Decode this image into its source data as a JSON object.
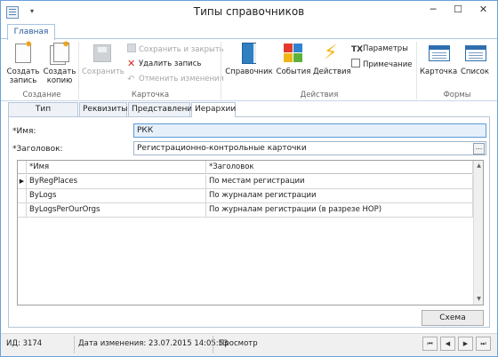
{
  "window": {
    "title": "Типы справочников",
    "quick_access": "▾",
    "minimize": "─",
    "maximize": "☐",
    "close": "✕"
  },
  "ribbon": {
    "tab_home": "Главная",
    "groups": {
      "create": {
        "label": "Создание",
        "create_record": [
          "Создать",
          "запись"
        ],
        "create_copy": [
          "Создать",
          "копию"
        ]
      },
      "card": {
        "label": "Карточка",
        "save": "Сохранить",
        "save_close": "Сохранить и закрыть",
        "delete_record": "Удалить запись",
        "cancel_changes": "Отменить изменения"
      },
      "actions": {
        "label": "Действия",
        "reference": "Справочник",
        "events": "События",
        "actions": "Действия",
        "parameters": "Параметры",
        "note": "Примечание"
      },
      "forms": {
        "label": "Формы",
        "card": "Карточка",
        "list": "Список"
      }
    }
  },
  "tabs": [
    {
      "label": "Тип справочника"
    },
    {
      "label": "Реквизиты"
    },
    {
      "label": "Представления"
    },
    {
      "label": "Иерархии"
    }
  ],
  "form": {
    "name_label": "*Имя:",
    "name_value": "РКК",
    "header_label": "*Заголовок:",
    "header_value": "Регистрационно-контрольные карточки",
    "dots": "..."
  },
  "grid": {
    "columns": [
      "*Имя",
      "*Заголовок"
    ],
    "rows": [
      {
        "name": "ByRegPlaces",
        "title": "По местам регистрации"
      },
      {
        "name": "ByLogs",
        "title": "По журналам регистрации"
      },
      {
        "name": "ByLogsPerOurOrgs",
        "title": "По журналам регистрации (в разрезе НОР)"
      }
    ]
  },
  "schema_button": "Схема",
  "status": {
    "id": "ИД: 3174",
    "modified": "Дата изменения: 23.07.2015 14:05:53",
    "mode": "Просмотр",
    "nav_first": "⏮",
    "nav_prev": "◀",
    "nav_next": "▶",
    "nav_last": "⏭"
  }
}
